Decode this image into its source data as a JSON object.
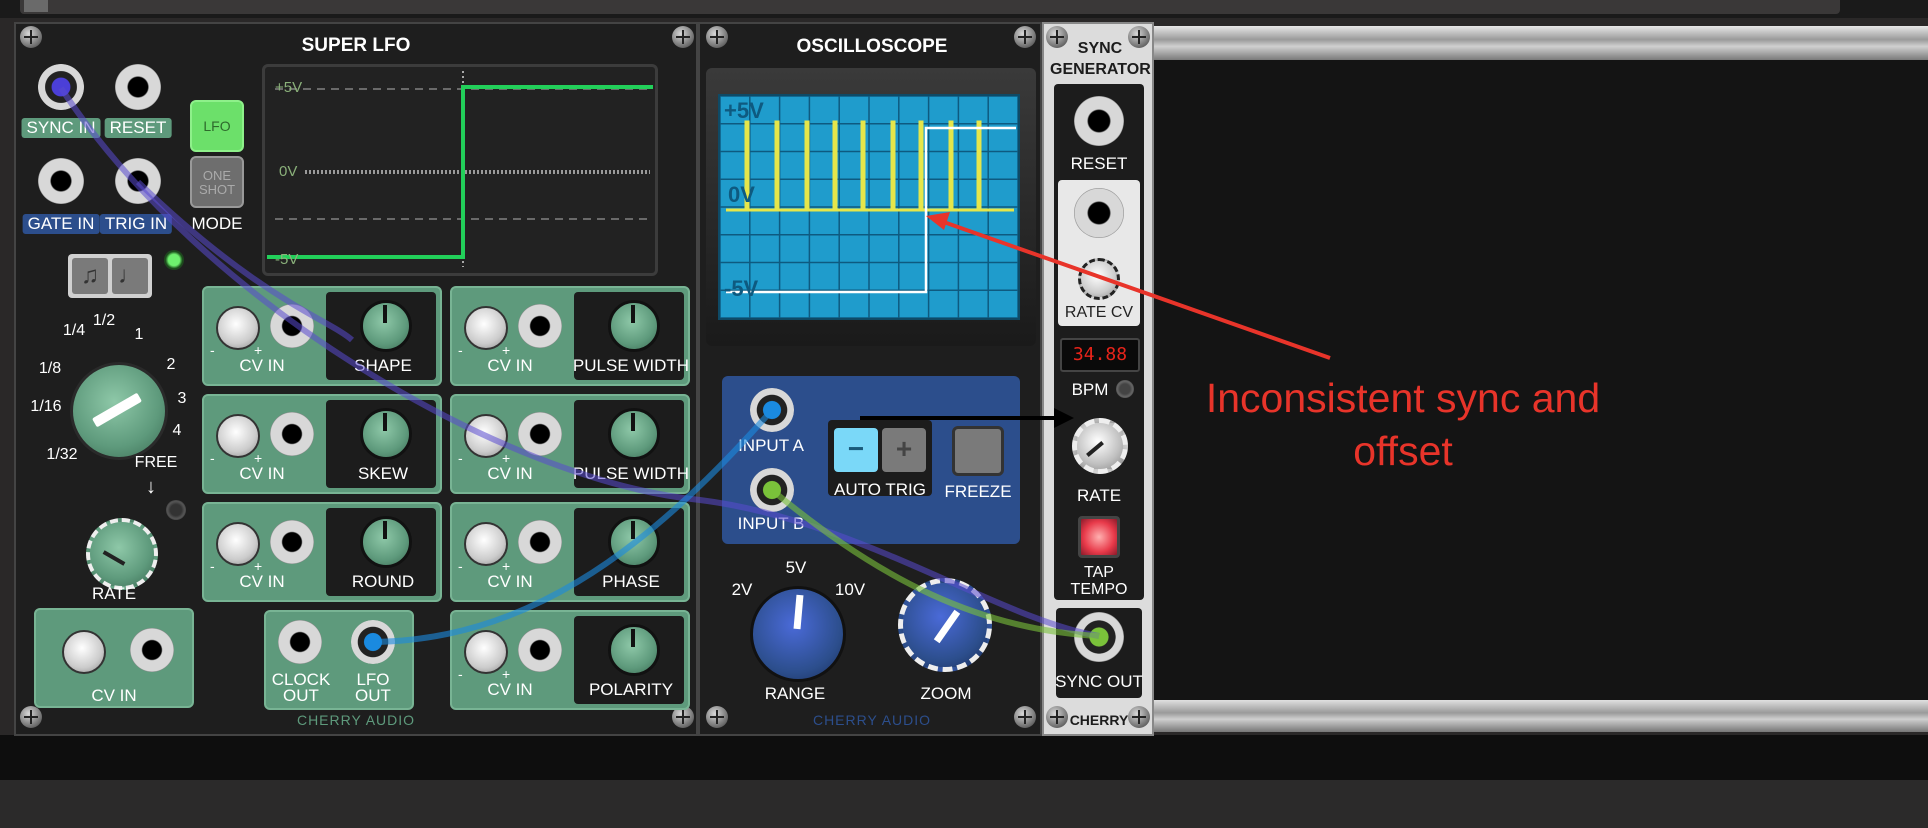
{
  "super_lfo": {
    "title": "SUPER LFO",
    "jacks": {
      "sync_in": "SYNC IN",
      "reset": "RESET",
      "gate_in": "GATE IN",
      "trig_in": "TRIG IN"
    },
    "mode_label": "MODE",
    "mode_buttons": {
      "lfo": "LFO",
      "one_shot_1": "ONE",
      "one_shot_2": "SHOT"
    },
    "display": {
      "plus": "+5V",
      "zero": "0V",
      "minus": "-5V"
    },
    "rate_dial_marks": [
      "1/4",
      "1/2",
      "1",
      "2",
      "3",
      "4",
      "1/8",
      "1/16",
      "1/32"
    ],
    "free_label": "FREE",
    "rate_label": "RATE",
    "cv_in": "CV IN",
    "minus": "-",
    "plus": "+",
    "params": {
      "shape": "SHAPE",
      "skew": "SKEW",
      "round": "ROUND",
      "pulse_width": "PULSE WIDTH",
      "phase": "PHASE",
      "polarity": "POLARITY"
    },
    "outputs": {
      "clock_out_1": "CLOCK",
      "clock_out_2": "OUT",
      "lfo_out_1": "LFO",
      "lfo_out_2": "OUT"
    },
    "brand": "CHERRY AUDIO"
  },
  "oscilloscope": {
    "title": "OSCILLOSCOPE",
    "screen": {
      "plus": "+5V",
      "zero": "0V",
      "minus": "-5V"
    },
    "input_a": "INPUT A",
    "input_b": "INPUT B",
    "auto_trig": "AUTO TRIG",
    "trig_minus": "−",
    "trig_plus": "+",
    "freeze": "FREEZE",
    "range_marks": {
      "low": "2V",
      "mid": "5V",
      "high": "10V"
    },
    "range_label": "RANGE",
    "zoom_label": "ZOOM",
    "brand": "CHERRY AUDIO"
  },
  "sync_generator": {
    "title_1": "SYNC",
    "title_2": "GENERATOR",
    "reset": "RESET",
    "rate_cv": "RATE CV",
    "bpm_value": "34.88",
    "bpm_label": "BPM",
    "rate_label": "RATE",
    "tap_1": "TAP",
    "tap_2": "TEMPO",
    "sync_out": "SYNC OUT",
    "brand": "CHERRY"
  },
  "annotation": {
    "line1": "Inconsistent sync and",
    "line2": "offset"
  },
  "colors": {
    "module_dark": "#1c1c1c",
    "lfo_green": "#5e9a7c",
    "scope_screen": "#1f9ccc",
    "annotation_red": "#e8342a",
    "trace_yellow": "#e6e64a",
    "trace_green": "#22d05a"
  }
}
